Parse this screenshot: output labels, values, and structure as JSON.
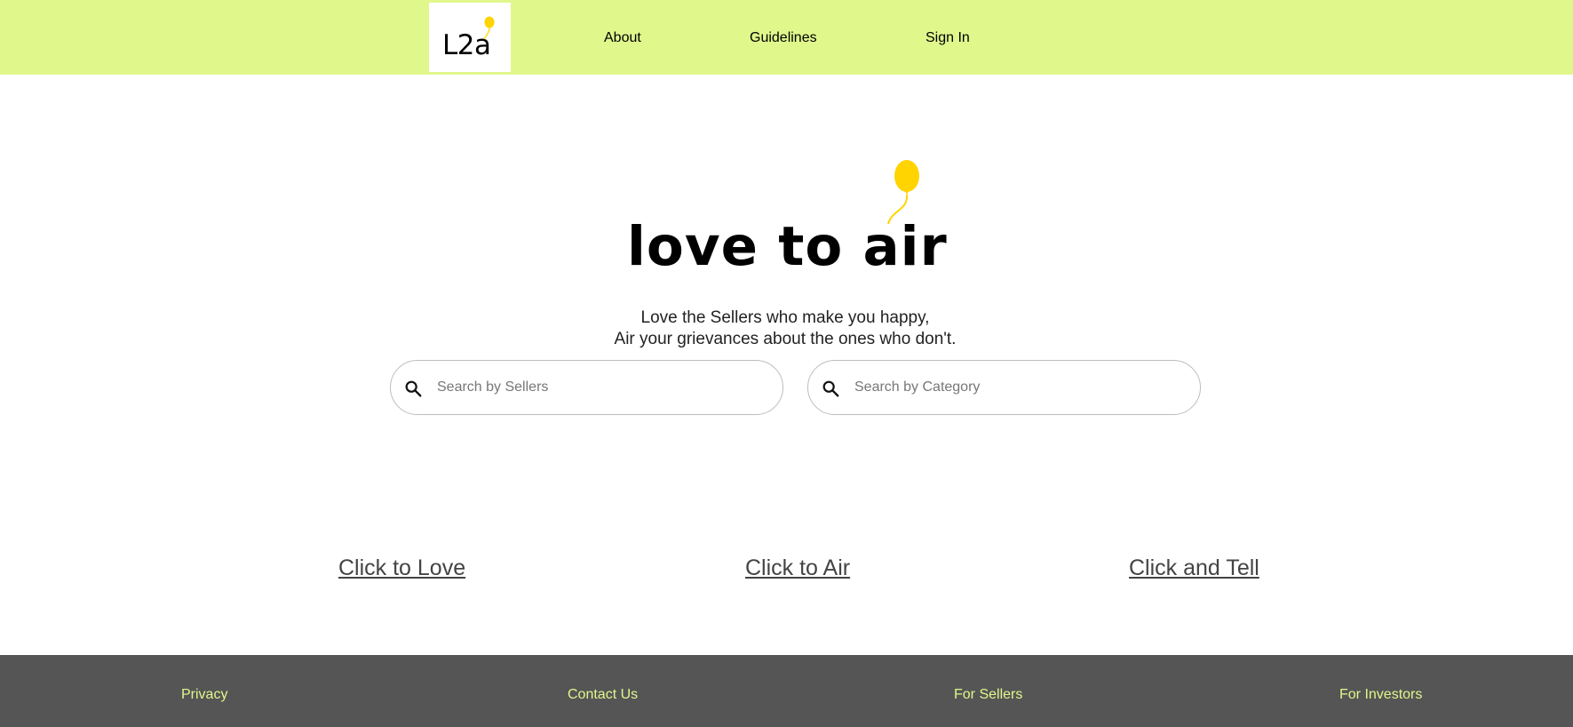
{
  "header": {
    "logo_text": "L2a",
    "nav": {
      "about": "About",
      "guidelines": "Guidelines",
      "sign_in": "Sign In"
    },
    "background_color": "#e0f78c"
  },
  "hero": {
    "logo_text": "love to air",
    "balloon_color": "#ffd400",
    "tagline_line1": "Love the Sellers who make you happy,",
    "tagline_line2": "Air your grievances about the ones who don't."
  },
  "search": {
    "sellers": {
      "icon": "search-icon",
      "placeholder": "Search by Sellers",
      "value": ""
    },
    "category": {
      "icon": "search-icon",
      "placeholder": "Search by Category",
      "value": ""
    }
  },
  "actions": {
    "love": "Click to Love",
    "air": "Click to Air",
    "tell": "Click and Tell"
  },
  "footer": {
    "privacy": "Privacy",
    "contact": "Contact Us",
    "for_sellers": "For Sellers",
    "for_investors": "For Investors",
    "background_color": "#555555",
    "link_color": "#e0f78c"
  }
}
